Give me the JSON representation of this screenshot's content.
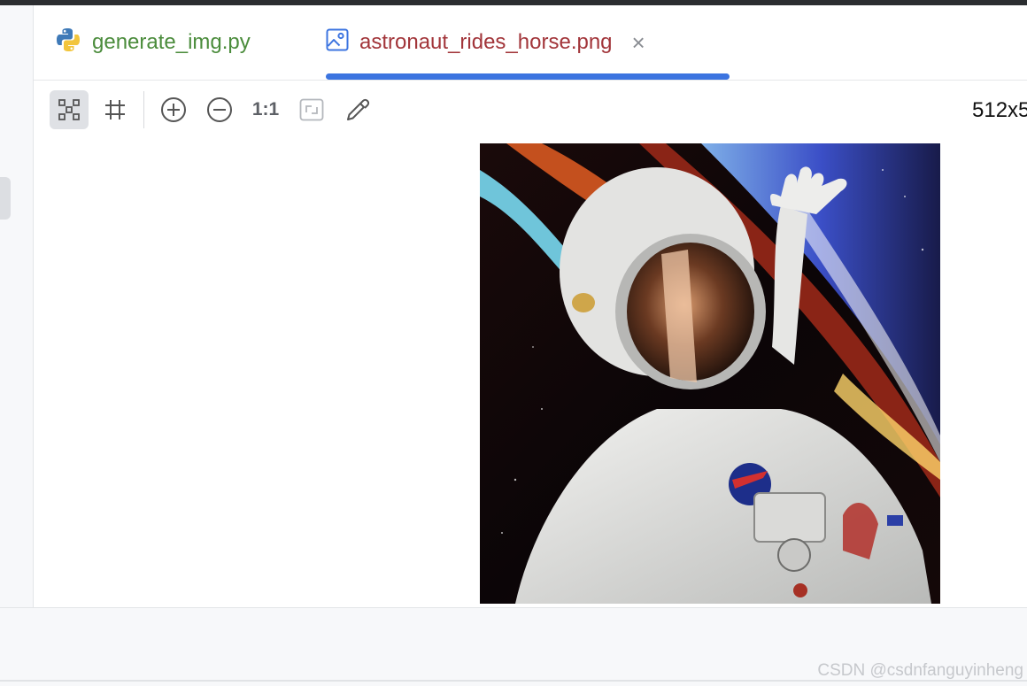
{
  "tabs": [
    {
      "label": "generate_img.py",
      "icon": "python-icon",
      "active": false
    },
    {
      "label": "astronaut_rides_horse.png",
      "icon": "image-file-icon",
      "active": true,
      "close_glyph": "×"
    }
  ],
  "toolbar": {
    "actual_size_label": "1:1",
    "image_size": "512x5",
    "buttons": [
      "chessboard-icon",
      "grid-icon",
      "zoom-in-icon",
      "zoom-out-icon",
      "actual-size-button",
      "fit-to-window-icon",
      "color-picker-icon"
    ]
  },
  "image": {
    "subject": "astronaut-floating-in-space"
  },
  "watermark": "CSDN @csdnfanguyinheng",
  "colors": {
    "accent": "#3c74e0",
    "python_tab_text": "#4b8c3c",
    "image_tab_text": "#a2353a"
  }
}
